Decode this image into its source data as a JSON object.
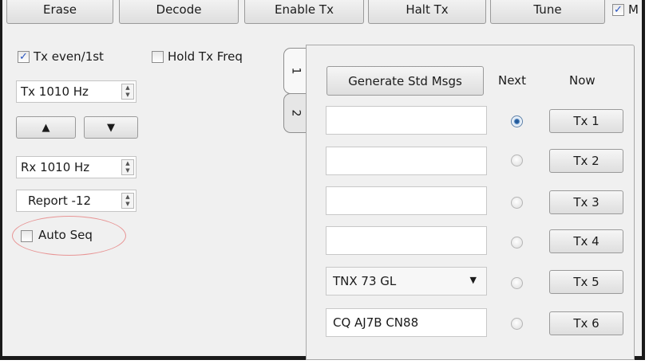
{
  "toolbar": {
    "erase": "Erase",
    "decode": "Decode",
    "enable_tx": "Enable Tx",
    "halt_tx": "Halt Tx",
    "tune": "Tune",
    "monitor_label": "M"
  },
  "left": {
    "tx_even": {
      "label": "Tx even/1st",
      "checked": true
    },
    "hold_tx_freq": {
      "label": "Hold Tx Freq",
      "checked": false
    },
    "tx_freq": "Tx  1010  Hz",
    "up_arrow": "▲",
    "down_arrow": "▼",
    "rx_freq": "Rx  1010  Hz",
    "report": "Report -12",
    "auto_seq": {
      "label": "Auto Seq",
      "checked": false
    }
  },
  "tabs": [
    "1",
    "2"
  ],
  "messages": {
    "generate_button": "Generate Std Msgs",
    "next_header": "Next",
    "now_header": "Now",
    "rows": [
      {
        "text": "",
        "next_selected": true,
        "button": "Tx 1"
      },
      {
        "text": "",
        "next_selected": false,
        "button": "Tx 2"
      },
      {
        "text": "",
        "next_selected": false,
        "button": "Tx 3"
      },
      {
        "text": "",
        "next_selected": false,
        "button": "Tx 4"
      },
      {
        "text": "TNX 73 GL",
        "next_selected": false,
        "button": "Tx 5",
        "dropdown": true
      },
      {
        "text": "CQ AJ7B CN88",
        "next_selected": false,
        "button": "Tx 6"
      }
    ]
  },
  "colors": {
    "background": "#f0f0f0",
    "check_mark": "#2a55c0",
    "highlight_oval": "#e89595",
    "radio_selected": "#1e4f8c"
  }
}
